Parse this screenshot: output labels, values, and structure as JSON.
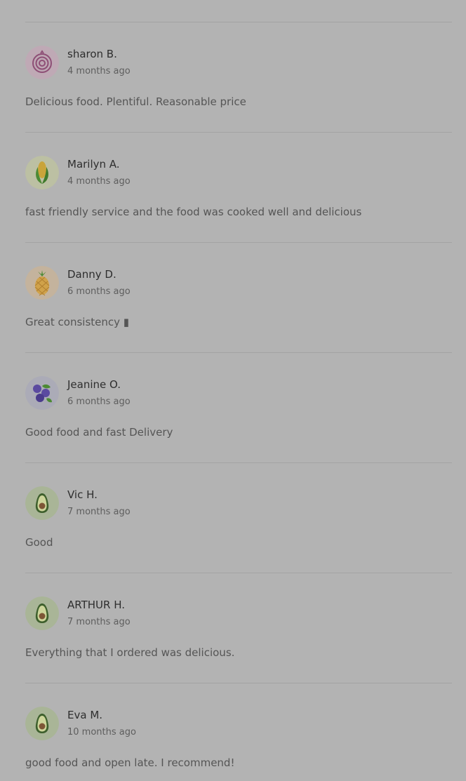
{
  "reviews": [
    {
      "name": "sharon B.",
      "date": "4 months ago",
      "text": "Delicious food. Plentiful. Reasonable price",
      "avatar_icon": "onion-icon"
    },
    {
      "name": "Marilyn A.",
      "date": "4 months ago",
      "text": "fast friendly service and the food was cooked well and delicious",
      "avatar_icon": "corn-icon"
    },
    {
      "name": "Danny D.",
      "date": "6 months ago",
      "text": "Great consistency ▮",
      "avatar_icon": "pineapple-icon"
    },
    {
      "name": "Jeanine O.",
      "date": "6 months ago",
      "text": "Good food and fast Delivery",
      "avatar_icon": "blueberries-icon"
    },
    {
      "name": "Vic H.",
      "date": "7 months ago",
      "text": "Good",
      "avatar_icon": "avocado-icon"
    },
    {
      "name": "ARTHUR H.",
      "date": "7 months ago",
      "text": "Everything that I ordered was delicious.",
      "avatar_icon": "avocado-icon"
    },
    {
      "name": "Eva M.",
      "date": "10 months ago",
      "text": "good food and open late. I recommend!",
      "avatar_icon": "avocado-icon"
    }
  ],
  "colors": {
    "background": "#b3b3b3",
    "divider": "#a3a3a3",
    "name": "#2e2e2e",
    "date": "#5e5e5e",
    "text": "#555555"
  }
}
